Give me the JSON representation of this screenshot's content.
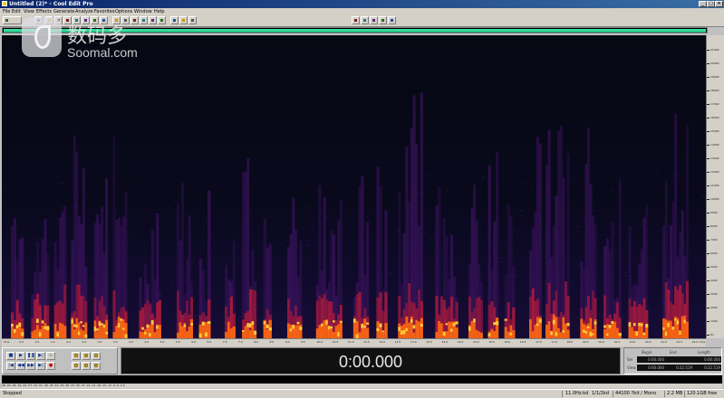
{
  "window": {
    "title": "Untitled (2)* - Cool Edit Pro"
  },
  "menu": [
    "File",
    "Edit",
    "View",
    "Effects",
    "Generate",
    "Analyze",
    "Favorites",
    "Options",
    "Window",
    "Help"
  ],
  "toolbar": {
    "button_icons": [
      "waveform-view-icon",
      "new-icon",
      "open-icon",
      "save-icon",
      "undo-icon",
      "cut-icon",
      "copy-icon",
      "paste-icon",
      "mix-paste-icon",
      "trim-icon",
      "zoom-icon",
      "select-icon",
      "scrub-icon",
      "hybrid-icon",
      "spectral-icon",
      "cue-icon",
      "metronome-icon",
      "marker-icon",
      "loop-icon",
      "help-icon",
      "level-icon",
      "analyze-icon",
      "settings-icon"
    ],
    "colors": {
      "accent": "#003399",
      "record": "#cc0000",
      "overview": "#33dd99"
    }
  },
  "spectral": {
    "view": "Spectral View",
    "freq_ticks": [
      "21000",
      "20000",
      "19000",
      "18000",
      "17000",
      "16000",
      "15000",
      "14000",
      "13000",
      "12000",
      "11000",
      "10000",
      "9000",
      "8000",
      "7000",
      "6000",
      "5000",
      "4000",
      "3000",
      "2000",
      "1000",
      "Hz"
    ],
    "time_ticks": [
      "hms",
      "0.5",
      "1.0",
      "1.5",
      "2.0",
      "2.5",
      "3.0",
      "3.5",
      "4.0",
      "4.5",
      "5.0",
      "5.5",
      "6.0",
      "6.5",
      "7.0",
      "7.5",
      "8.0",
      "8.5",
      "9.0",
      "9.5",
      "10.0",
      "10.5",
      "11.0",
      "11.5",
      "12.0",
      "12.5",
      "13.0",
      "13.5",
      "14.0",
      "14.5",
      "15.0",
      "15.5",
      "16.0",
      "16.5",
      "17.0",
      "17.5",
      "18.0",
      "18.5",
      "19.0",
      "19.5",
      "20.0",
      "20.5",
      "21.0",
      "21.5",
      "22.0",
      "hms"
    ]
  },
  "transport": {
    "buttons": [
      "stop-icon",
      "play-icon",
      "pause-icon",
      "play-to-end-icon",
      "loop-icon",
      "go-to-start-icon",
      "rewind-icon",
      "fast-forward-icon",
      "go-to-end-icon",
      "record-icon"
    ],
    "glyphs": [
      "■",
      "▶",
      "❚❚",
      "▶|",
      "∞",
      "|◀",
      "◀◀",
      "▶▶",
      "▶|",
      "●"
    ],
    "zoom_buttons": [
      "zoom-in-h-icon",
      "zoom-out-h-icon",
      "zoom-full-icon",
      "zoom-in-v-icon",
      "zoom-out-v-icon",
      "zoom-sel-icon"
    ]
  },
  "time_display": "0:00.000",
  "selection": {
    "headers": [
      "Begin",
      "End",
      "Length"
    ],
    "rows": [
      {
        "label": "Sel",
        "values": [
          "0:00.000",
          "",
          "0:00.000"
        ]
      },
      {
        "label": "View",
        "values": [
          "0:00.000",
          "0:22.519",
          "0:22.519"
        ]
      }
    ]
  },
  "level_scale": "dB -69 -66 -63 -60 -57 -54 -51 -48 -45 -42 -39 -36 -33 -30 -27 -24 -21 -18 -15 -12 -9 -6 -3 0",
  "status": {
    "state": "Stopped",
    "fields": [
      "11.0Hz:kd",
      "1/1/2kd",
      "44100 ?bit / Mono",
      "2.2 MB",
      "120.1GB free"
    ]
  },
  "watermark": {
    "cn": "数码多",
    "en": "Soomal.com"
  }
}
